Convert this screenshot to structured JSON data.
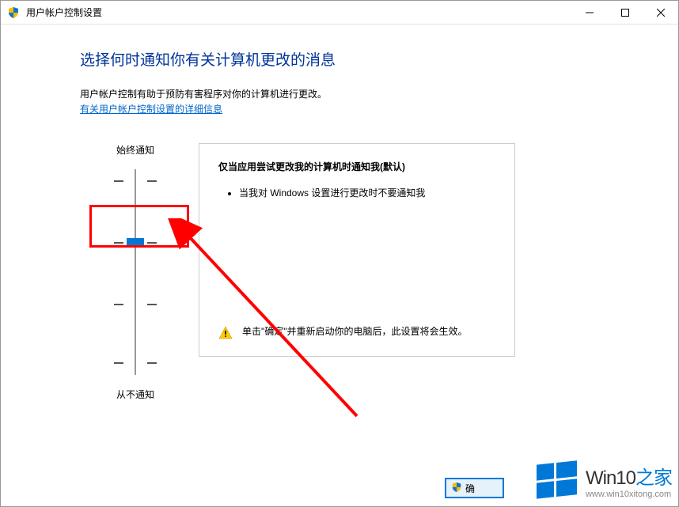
{
  "titlebar": {
    "title": "用户帐户控制设置"
  },
  "main": {
    "heading": "选择何时通知你有关计算机更改的消息",
    "description": "用户帐户控制有助于预防有害程序对你的计算机进行更改。",
    "info_link": "有关用户帐户控制设置的详细信息"
  },
  "slider": {
    "label_always": "始终通知",
    "label_never": "从不通知"
  },
  "panel": {
    "title": "仅当应用尝试更改我的计算机时通知我(默认)",
    "bullet1": "当我对 Windows 设置进行更改时不要通知我",
    "warning_text": "单击\"确定\"并重新启动你的电脑后，此设置将会生效。"
  },
  "button": {
    "partial_text": "确"
  },
  "watermark": {
    "brand_main": "Win10",
    "brand_accent": "之家",
    "url": "www.win10xitong.com"
  }
}
